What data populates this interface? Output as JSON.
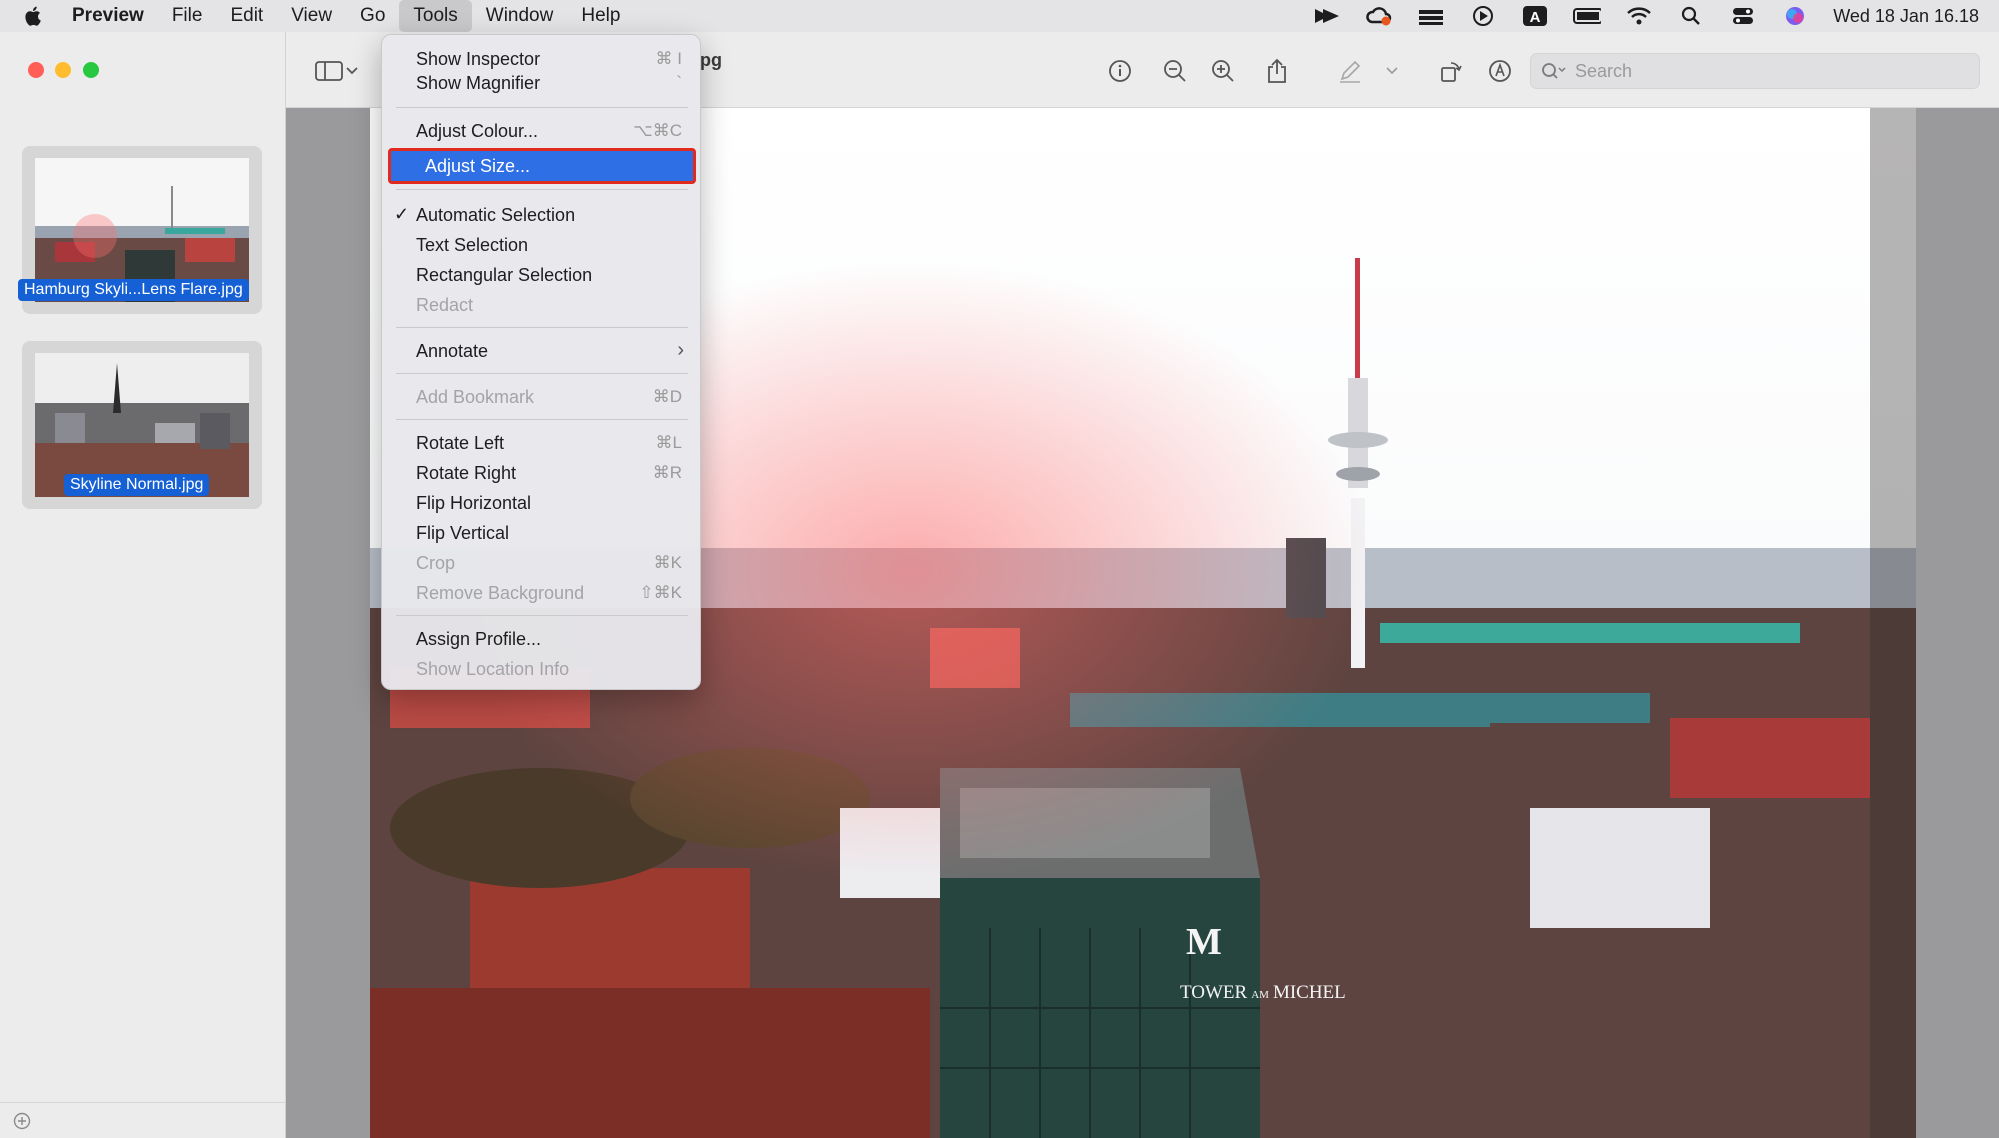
{
  "menubar": {
    "app": "Preview",
    "items": [
      "File",
      "Edit",
      "View",
      "Go",
      "Tools",
      "Window",
      "Help"
    ],
    "clock": "Wed 18 Jan 16.18"
  },
  "toolbar": {
    "doc_title_fragment": "pg",
    "search_placeholder": "Search"
  },
  "sidebar": {
    "thumbnails": [
      {
        "label": "Hamburg Skyli...Lens Flare.jpg"
      },
      {
        "label": "Skyline Normal.jpg"
      }
    ]
  },
  "tools_menu": {
    "items": [
      {
        "label": "Show Inspector",
        "shortcut": "⌘ I",
        "enabled": true
      },
      {
        "label": "Show Magnifier",
        "shortcut": "`",
        "enabled": true
      },
      {
        "label": "Adjust Colour...",
        "shortcut": "⌥⌘C",
        "enabled": true
      },
      {
        "label": "Adjust Size...",
        "shortcut": "",
        "enabled": true,
        "highlighted": true
      },
      {
        "label": "Automatic Selection",
        "checked": true,
        "enabled": true
      },
      {
        "label": "Text Selection",
        "enabled": true
      },
      {
        "label": "Rectangular Selection",
        "enabled": true
      },
      {
        "label": "Redact",
        "enabled": false
      },
      {
        "label": "Annotate",
        "submenu": true,
        "enabled": true
      },
      {
        "label": "Add Bookmark",
        "shortcut": "⌘D",
        "enabled": false
      },
      {
        "label": "Rotate Left",
        "shortcut": "⌘L",
        "enabled": true
      },
      {
        "label": "Rotate Right",
        "shortcut": "⌘R",
        "enabled": true
      },
      {
        "label": "Flip Horizontal",
        "enabled": true
      },
      {
        "label": "Flip Vertical",
        "enabled": true
      },
      {
        "label": "Crop",
        "shortcut": "⌘K",
        "enabled": false
      },
      {
        "label": "Remove Background",
        "shortcut": "⇧⌘K",
        "enabled": false
      },
      {
        "label": "Assign Profile...",
        "enabled": true
      },
      {
        "label": "Show Location Info",
        "enabled": false
      }
    ]
  },
  "photo": {
    "building_sign_line1": "M",
    "building_sign_line2": "TOWER",
    "building_sign_line3": "AM",
    "building_sign_line4": "MICHEL"
  },
  "colors": {
    "menu_highlight": "#2e6fe6",
    "highlight_border": "#e12a1e",
    "selection_label": "#1560d4"
  }
}
